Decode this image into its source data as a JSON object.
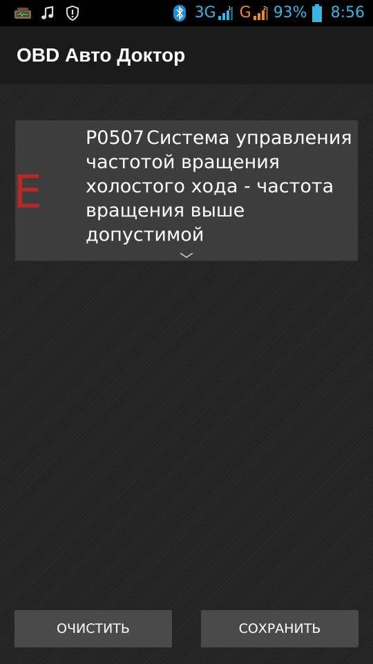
{
  "status_bar": {
    "icons_left": [
      "car-notification-icon",
      "music-note-icon",
      "shield-icon"
    ],
    "bluetooth_icon": "bluetooth-icon",
    "network_1": "3G",
    "network_1_color": "#33b5e5",
    "network_2": "G",
    "network_2_color": "#f28a1b",
    "battery_percent": "93%",
    "time": "8:56",
    "accent_color": "#33b5e5"
  },
  "action_bar": {
    "title": "OBD Авто Доктор"
  },
  "error_card": {
    "severity": "E",
    "severity_color": "#b92828",
    "code": "P0507",
    "description": "Система управления частотой вращения холостого хода - частота вращения выше допустимой",
    "expand_icon": "chevron-down-icon"
  },
  "buttons": {
    "clear_label": "ОЧИСТИТЬ",
    "save_label": "СОХРАНИТЬ"
  }
}
